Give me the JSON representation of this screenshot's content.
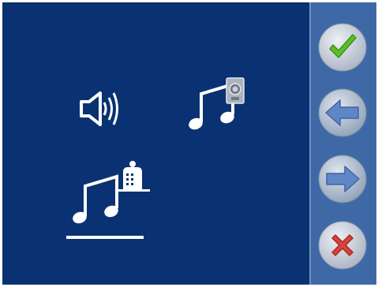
{
  "main_panel": {
    "options": [
      {
        "id": "speaker-volume",
        "icon": "speaker-volume-icon"
      },
      {
        "id": "door-melody",
        "icon": "music-notes-door-icon"
      },
      {
        "id": "concierge-melody",
        "icon": "music-notes-concierge-icon",
        "selected": true
      }
    ]
  },
  "side_panel": {
    "buttons": [
      {
        "id": "confirm",
        "icon": "check-icon",
        "color": "#5bbf2a"
      },
      {
        "id": "back",
        "icon": "arrow-left-icon",
        "color": "#5f86c6"
      },
      {
        "id": "next",
        "icon": "arrow-right-icon",
        "color": "#5f86c6"
      },
      {
        "id": "cancel",
        "icon": "cross-icon",
        "color": "#d9433a"
      }
    ]
  },
  "colors": {
    "background": "#0a3272",
    "side_panel": "#3f69a6",
    "button_face": "#c8cfd9",
    "icon_white": "#ffffff"
  }
}
